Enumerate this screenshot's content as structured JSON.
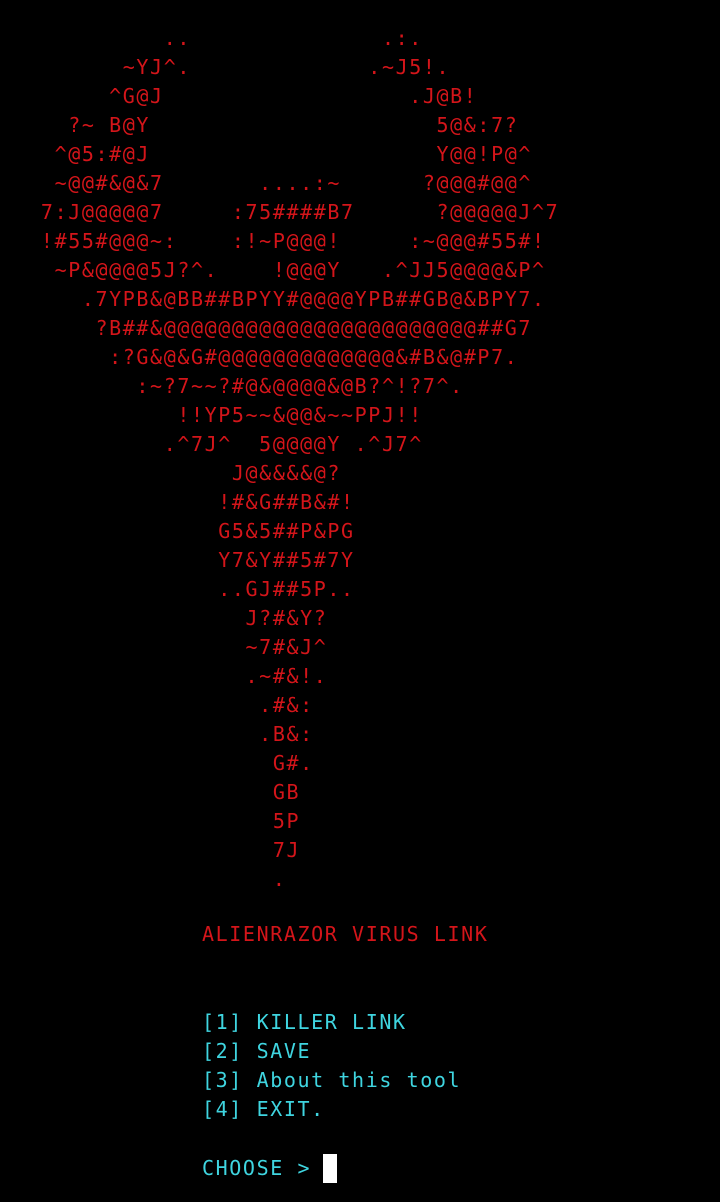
{
  "colors": {
    "background": "#000000",
    "banner": "#d4151a",
    "menu": "#3fd5e0",
    "cursor": "#ffffff"
  },
  "banner": {
    "lines": [
      "            ..              .:.",
      "         ~YJ^.             .~J5!.",
      "        ^G@J                  .J@B!",
      "     ?~ B@Y                     5@&:7?",
      "    ^@5:#@J                     Y@@!P@^",
      "    ~@@#&@&7       ....:~      ?@@@#@@^",
      "   7:J@@@@@7     :75####B7      ?@@@@@J^7",
      "   !#55#@@@~:    :!~P@@@!     :~@@@#55#!",
      "    ~P&@@@@5J?^.    !@@@Y   .^JJ5@@@@&P^",
      "      .7YPB&@BB##BPYY#@@@@YPB##GB@&BPY7.",
      "       ?B##&@@@@@@@@@@@@@@@@@@@@@@@##G7",
      "        :?G&@&G#@@@@@@@@@@@@@&#B&@#P7.",
      "          :~?7~~?#@&@@@@&@B?^!?7^.",
      "             !!YP5~~&@@&~~PPJ!!",
      "            .^7J^  5@@@@Y .^J7^",
      "                 J@&&&&@?",
      "                !#&G##B&#!",
      "                G5&5##P&PG",
      "                Y7&Y##5#7Y",
      "                ..GJ##5P..",
      "                  J?#&Y?",
      "                  ~7#&J^",
      "                  .~#&!.",
      "                   .#&:",
      "                   .B&:",
      "                    G#.",
      "                    GB",
      "                    5P",
      "                    7J",
      "                    ."
    ]
  },
  "title": "ALIENRAZOR VIRUS LINK",
  "menu": {
    "items": [
      "[1] KILLER LINK",
      "[2] SAVE",
      "[3] About this tool",
      "[4] EXIT."
    ]
  },
  "prompt": {
    "label": "CHOOSE >"
  }
}
